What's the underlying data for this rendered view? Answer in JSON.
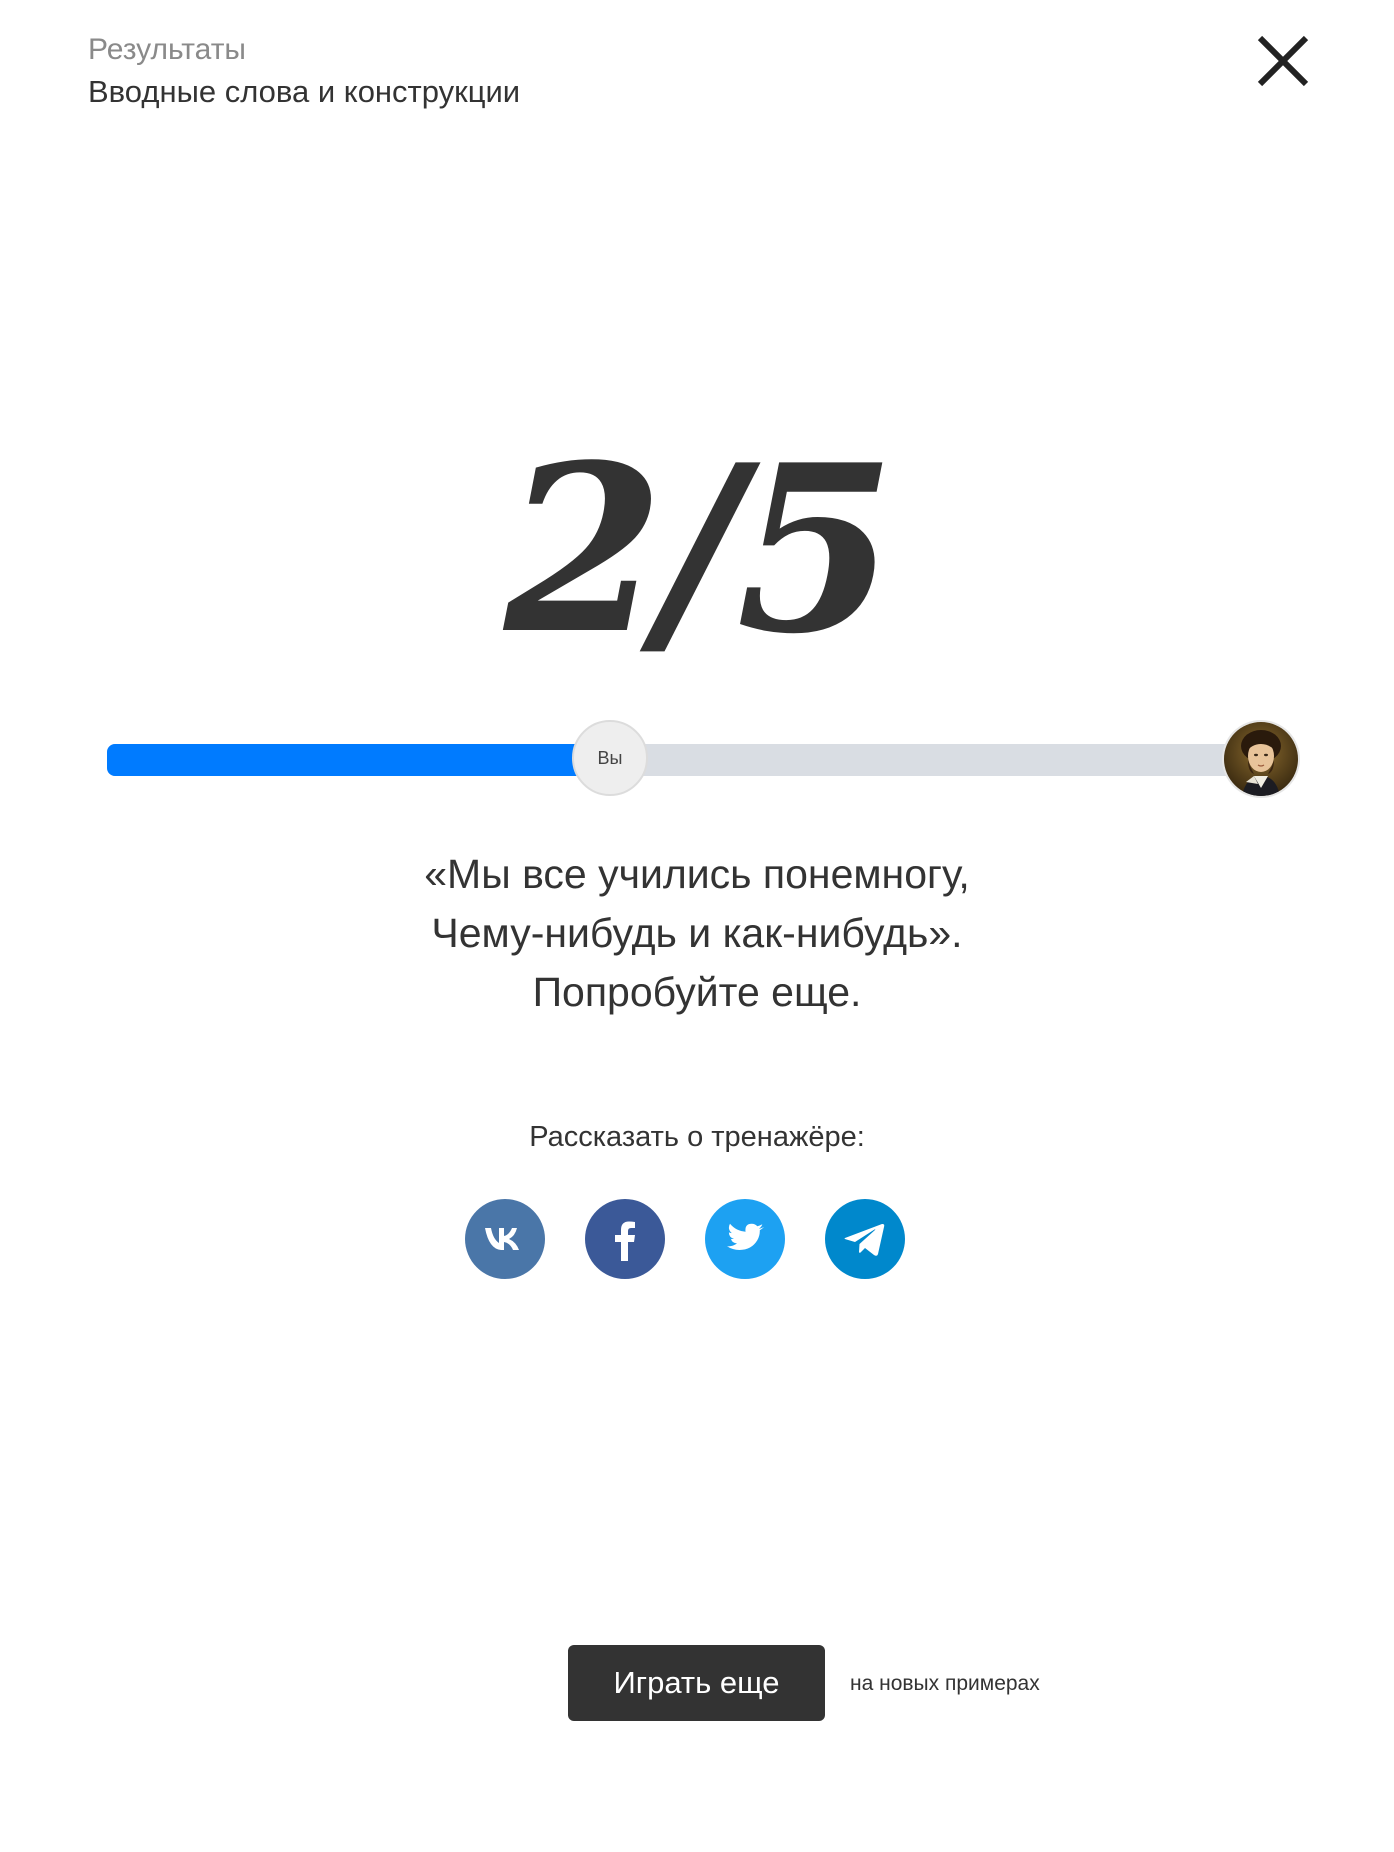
{
  "header": {
    "subtitle": "Результаты",
    "title": "Вводные слова и конструкции"
  },
  "close_icon": "close-icon",
  "score": {
    "text": "2/5",
    "correct": 2,
    "total": 5
  },
  "progress": {
    "fraction": 0.4,
    "marker_label": "Вы",
    "track_color": "#d9dde3",
    "fill_color": "#007bff",
    "avatar_icon": "pushkin-portrait-avatar"
  },
  "quote": {
    "lines": [
      "«Мы все учились понемногу,",
      "Чему-нибудь и как-нибудь».",
      "Попробуйте еще."
    ]
  },
  "share": {
    "label": "Рассказать о тренажёре:",
    "buttons": [
      {
        "icon": "vk-icon",
        "color": "#4a76a8"
      },
      {
        "icon": "facebook-icon",
        "color": "#3b5998"
      },
      {
        "icon": "twitter-icon",
        "color": "#1da1f2"
      },
      {
        "icon": "telegram-icon",
        "color": "#0088cc"
      }
    ]
  },
  "actions": {
    "play_label": "Играть еще",
    "play_note": "на новых примерах"
  }
}
